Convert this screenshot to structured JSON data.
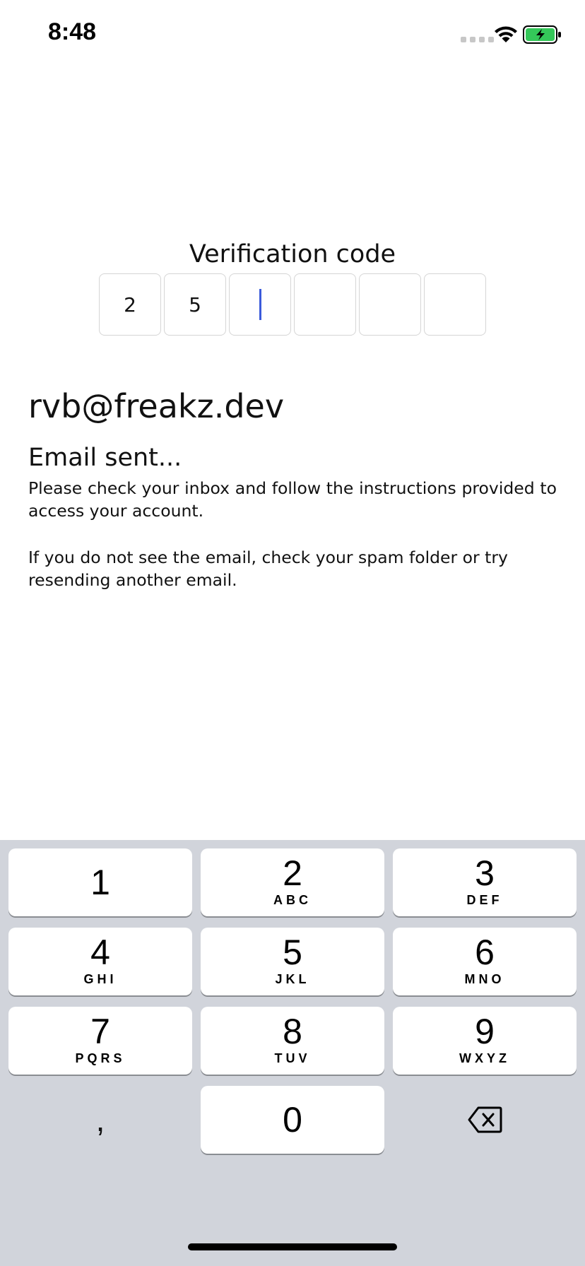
{
  "status_bar": {
    "time": "8:48",
    "battery_color": "#34c759"
  },
  "verification": {
    "title": "Verification code",
    "digits": [
      "2",
      "5",
      "",
      "",
      "",
      ""
    ],
    "cursor_color": "#3b5bdb"
  },
  "account": {
    "email": "rvb@freakz.dev"
  },
  "message": {
    "title": "Email sent...",
    "line1": "Please check your inbox and follow the instructions provided to access your account.",
    "line2": "If you do not see the email, check your spam folder or try resending another email."
  },
  "keyboard": {
    "keys": [
      {
        "digit": "1",
        "letters": ""
      },
      {
        "digit": "2",
        "letters": "ABC"
      },
      {
        "digit": "3",
        "letters": "DEF"
      },
      {
        "digit": "4",
        "letters": "GHI"
      },
      {
        "digit": "5",
        "letters": "JKL"
      },
      {
        "digit": "6",
        "letters": "MNO"
      },
      {
        "digit": "7",
        "letters": "PQRS"
      },
      {
        "digit": "8",
        "letters": "TUV"
      },
      {
        "digit": "9",
        "letters": "WXYZ"
      },
      {
        "digit": "0",
        "letters": ""
      }
    ],
    "comma": ",",
    "delete_icon": "backspace-icon",
    "background": "#d1d4db"
  }
}
